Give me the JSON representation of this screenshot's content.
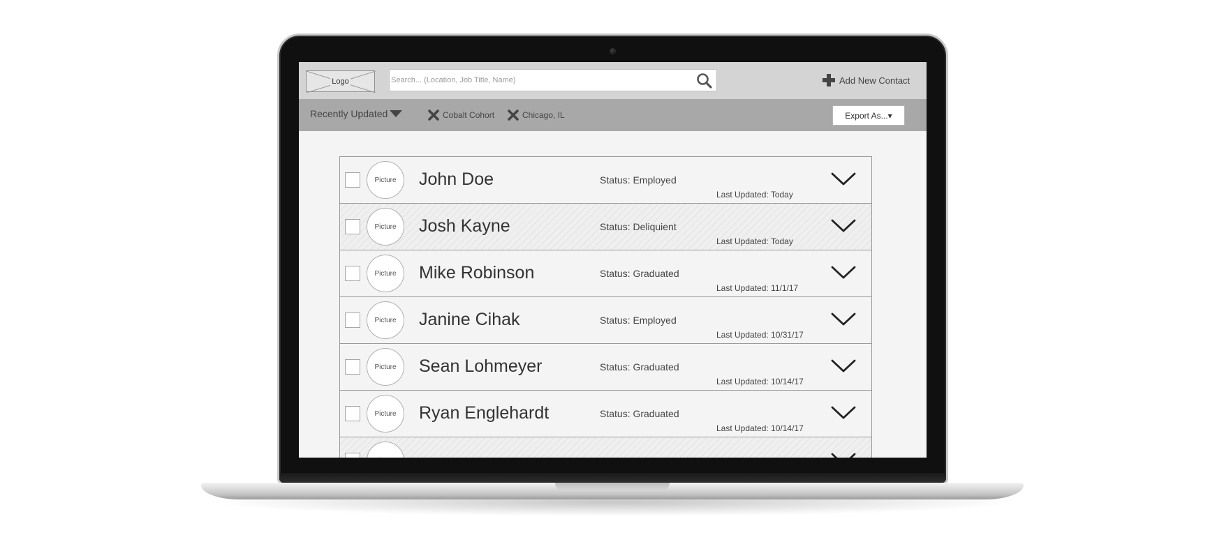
{
  "topbar": {
    "logo_label": "Logo",
    "search_placeholder": "Search... (Location, Job Title, Name)",
    "add_contact_label": "Add New Contact"
  },
  "filterbar": {
    "sort_label": "Recently Updated",
    "filters": [
      "Cobalt Cohort",
      "Chicago, IL"
    ],
    "export_label": "Export As...▾"
  },
  "picture_label": "Picture",
  "contacts": [
    {
      "name": "John Doe",
      "status": "Status: Employed",
      "updated": "Last Updated: Today",
      "striped": false
    },
    {
      "name": "Josh Kayne",
      "status": "Status: Deliquient",
      "updated": "Last Updated: Today",
      "striped": true
    },
    {
      "name": "Mike Robinson",
      "status": "Status: Graduated",
      "updated": "Last Updated: 11/1/17",
      "striped": false
    },
    {
      "name": "Janine Cihak",
      "status": "Status: Employed",
      "updated": "Last Updated: 10/31/17",
      "striped": false
    },
    {
      "name": "Sean Lohmeyer",
      "status": "Status: Graduated",
      "updated": "Last Updated: 10/14/17",
      "striped": false
    },
    {
      "name": "Ryan Englehardt",
      "status": "Status: Graduated",
      "updated": "Last Updated: 10/14/17",
      "striped": false
    },
    {
      "name": "",
      "status": "",
      "updated": "",
      "striped": true
    }
  ],
  "icons": {
    "search": "search-icon",
    "add": "plus-icon",
    "sort": "caret-down-icon",
    "remove_filter": "x-icon",
    "expand": "chevron-down-icon"
  },
  "colors": {
    "topbar": "#d4d4d4",
    "filterbar": "#a8a8a8",
    "screen_bg": "#f4f4f4",
    "text": "#333333"
  }
}
